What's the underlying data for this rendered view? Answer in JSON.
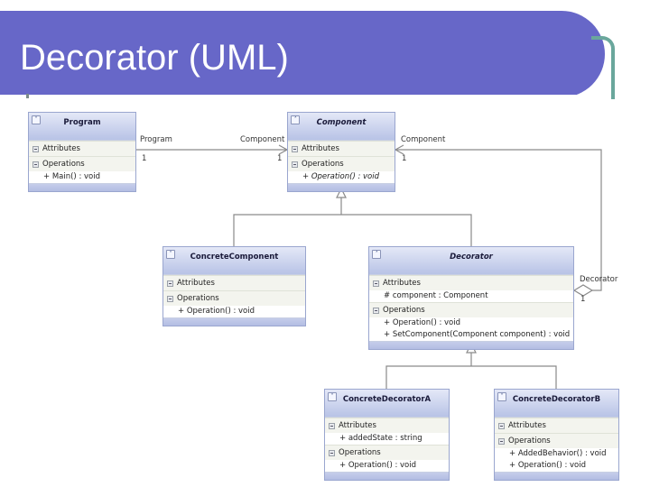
{
  "slide": {
    "title": "Decorator (UML)",
    "colors": {
      "title_bar": "#6767c8",
      "accent_hook": "#6aa79c",
      "class_border": "#9aa6cf"
    }
  },
  "diagram": {
    "section_attributes": "Attributes",
    "section_operations": "Operations",
    "collapse_glyph": "˄",
    "classes": {
      "program": {
        "name": "Program",
        "abstract": false,
        "attributes": [],
        "operations": [
          "+ Main() : void"
        ]
      },
      "component": {
        "name": "Component",
        "abstract": true,
        "attributes": [],
        "operations": [
          "+ Operation() : void"
        ]
      },
      "concrete_component": {
        "name": "ConcreteComponent",
        "abstract": false,
        "attributes": [],
        "operations": [
          "+ Operation() : void"
        ]
      },
      "decorator": {
        "name": "Decorator",
        "abstract": true,
        "attributes": [
          "# component : Component"
        ],
        "operations": [
          "+ Operation() : void",
          "+ SetComponent(Component component) : void"
        ]
      },
      "concrete_decorator_a": {
        "name": "ConcreteDecoratorA",
        "abstract": false,
        "attributes": [
          "+ addedState : string"
        ],
        "operations": [
          "+ Operation() : void"
        ]
      },
      "concrete_decorator_b": {
        "name": "ConcreteDecoratorB",
        "abstract": false,
        "attributes": [],
        "operations": [
          "+ AddedBehavior() : void",
          "+ Operation() : void"
        ]
      }
    },
    "associations": {
      "program_component": {
        "source_role": "Program",
        "source_mult": "1",
        "target_role": "Component",
        "target_mult": "1"
      },
      "decorator_component": {
        "target_role": "Component",
        "target_mult": "1",
        "source_role": "Decorator",
        "source_mult": "1"
      }
    }
  }
}
